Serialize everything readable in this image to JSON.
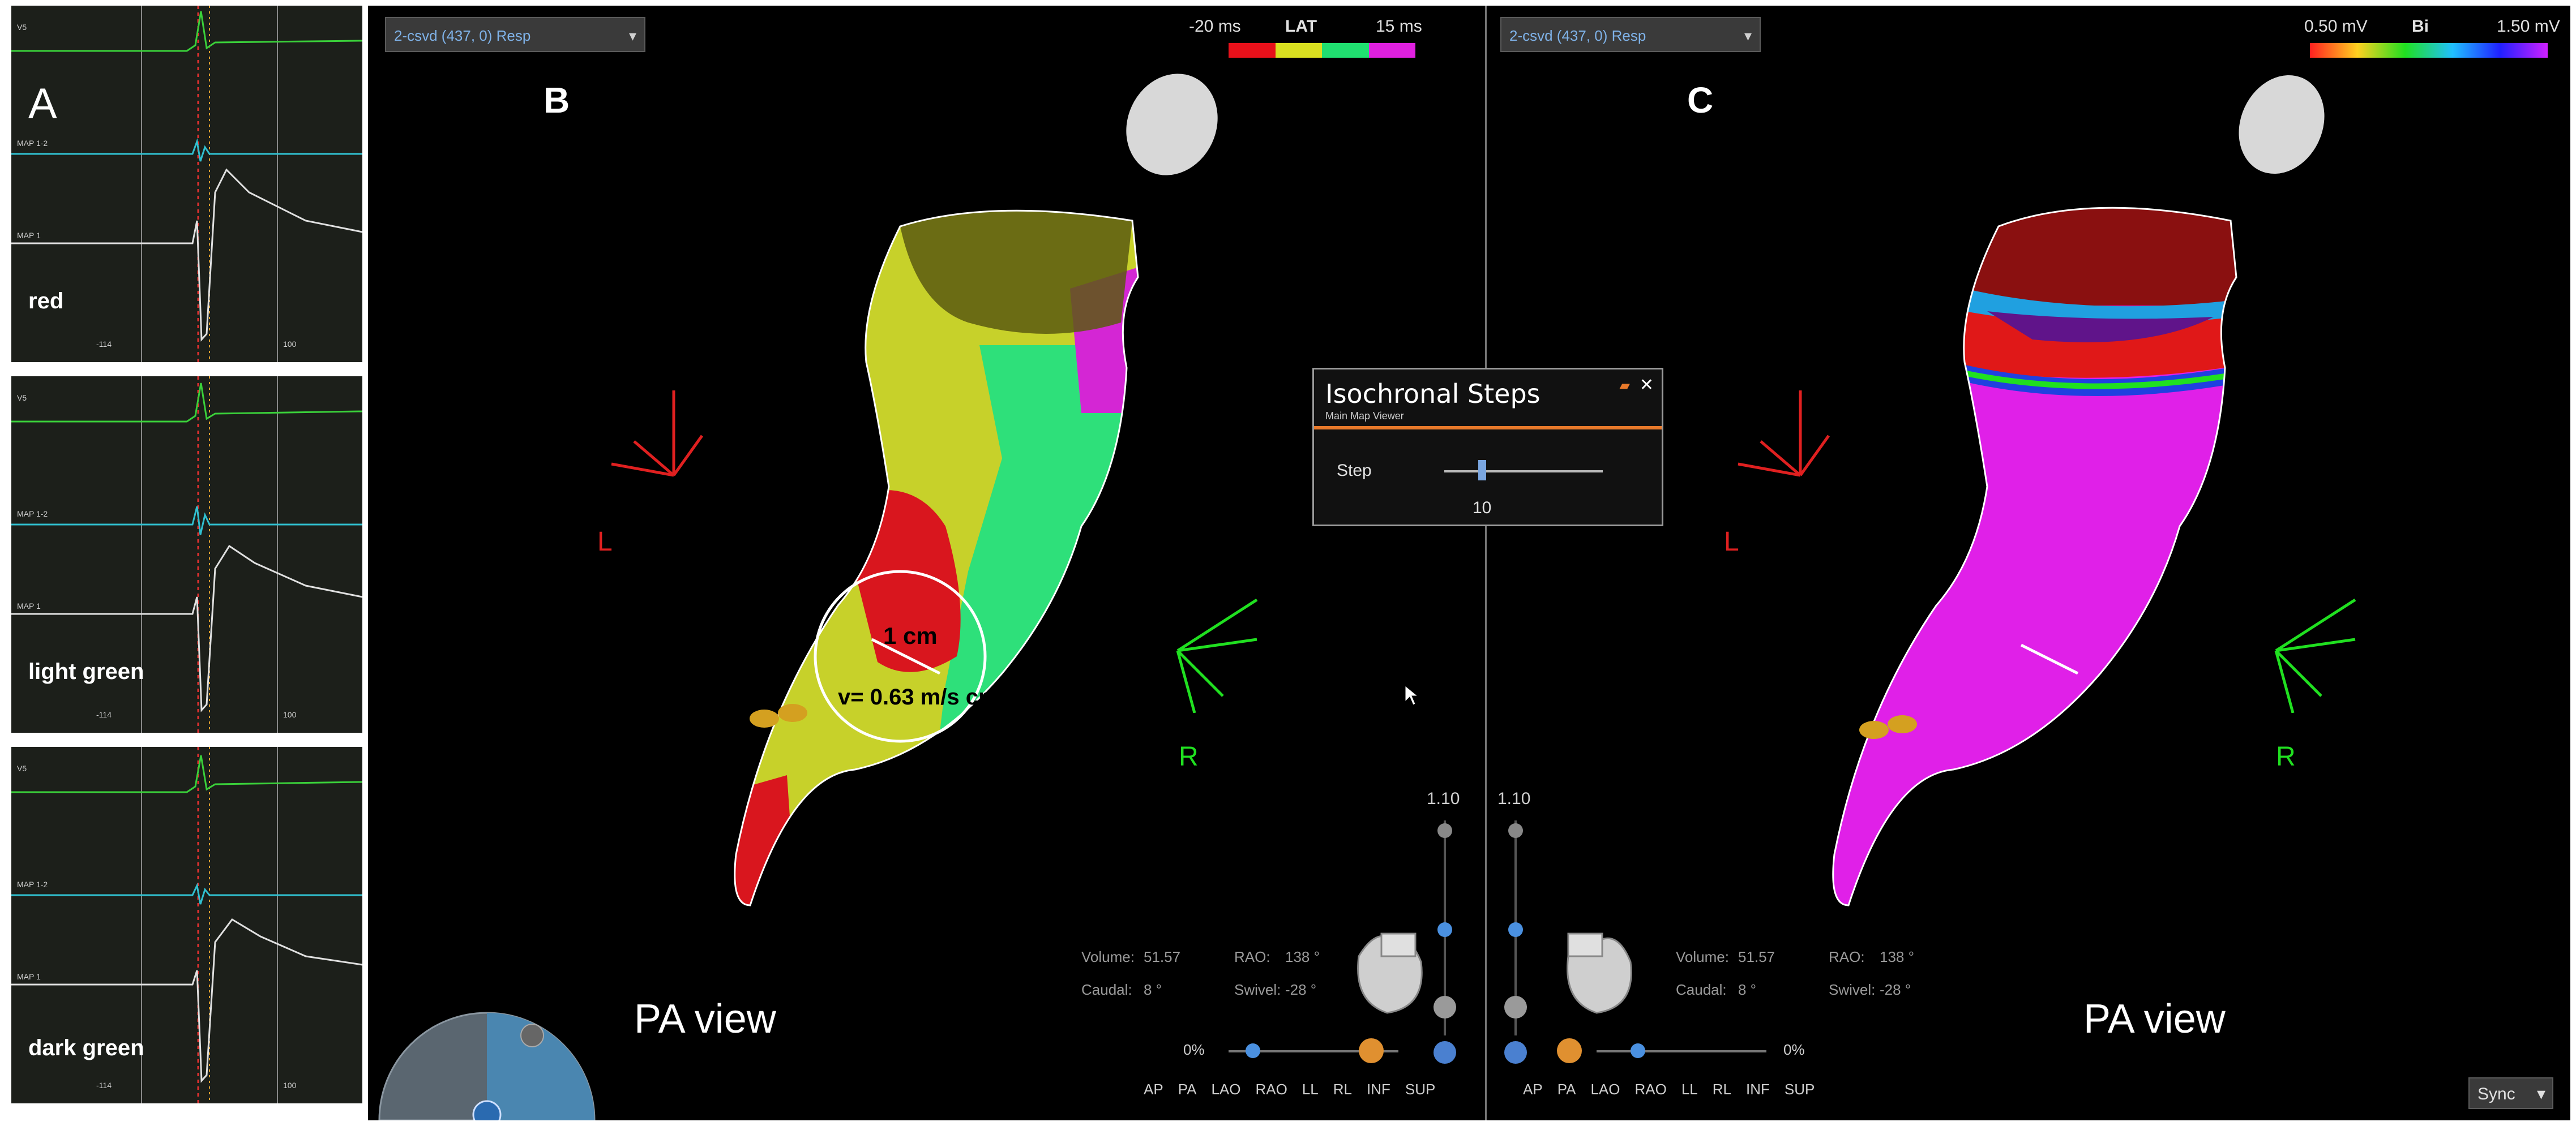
{
  "panel_a": {
    "letter": "A",
    "traces": [
      {
        "label": "red",
        "ch1": "V5",
        "ch2": "MAP 1-2",
        "ch3": "MAP 1",
        "t_left": "-114",
        "t_right": "100"
      },
      {
        "label": "light green",
        "ch1": "V5",
        "ch2": "MAP 1-2",
        "ch3": "MAP 1",
        "t_left": "-114",
        "t_right": "100"
      },
      {
        "label": "dark green",
        "ch1": "V5",
        "ch2": "MAP 1-2",
        "ch3": "MAP 1",
        "t_left": "-114",
        "t_right": "100"
      }
    ]
  },
  "panel_b": {
    "letter": "B",
    "tab_label": "2-csvd (437, 0) Resp",
    "colorbar": {
      "min": "-20 ms",
      "name": "LAT",
      "max": "15 ms"
    },
    "axis_labels": {
      "left": "L",
      "right": "R"
    },
    "annotation_distance": "1 cm",
    "annotation_velocity": "v= 0.63 m/s cm",
    "view_label": "PA view",
    "info": {
      "volume_label": "Volume:",
      "volume_value": "51.57",
      "rao_label": "RAO:",
      "rao_value": "138 °",
      "caudal_label": "Caudal:",
      "caudal_value": "8 °",
      "swivel_label": "Swivel:",
      "swivel_value": "-28 °"
    },
    "zoom": "1.10",
    "opacity": "0%",
    "nav": [
      "AP",
      "PA",
      "LAO",
      "RAO",
      "LL",
      "RL",
      "INF",
      "SUP"
    ]
  },
  "panel_c": {
    "letter": "C",
    "tab_label": "2-csvd (437, 0) Resp",
    "colorbar": {
      "min": "0.50 mV",
      "name": "Bi",
      "max": "1.50 mV"
    },
    "axis_labels": {
      "left": "L",
      "right": "R"
    },
    "view_label": "PA view",
    "info": {
      "volume_label": "Volume:",
      "volume_value": "51.57",
      "rao_label": "RAO:",
      "rao_value": "138 °",
      "caudal_label": "Caudal:",
      "caudal_value": "8 °",
      "swivel_label": "Swivel:",
      "swivel_value": "-28 °"
    },
    "zoom": "1.10",
    "opacity": "0%",
    "nav": [
      "AP",
      "PA",
      "LAO",
      "RAO",
      "LL",
      "RL",
      "INF",
      "SUP"
    ],
    "sync_label": "Sync"
  },
  "isochronal_dialog": {
    "title": "Isochronal Steps",
    "subtitle": "Main Map Viewer",
    "step_label": "Step",
    "step_value": "10"
  },
  "colors": {
    "lat_scale": [
      "#e8101a",
      "#d9e020",
      "#20e070",
      "#e020e0"
    ],
    "bi_scale": [
      "#ff2020",
      "#ffd020",
      "#20e020",
      "#20c0ff",
      "#2020ff",
      "#d020ff"
    ]
  }
}
